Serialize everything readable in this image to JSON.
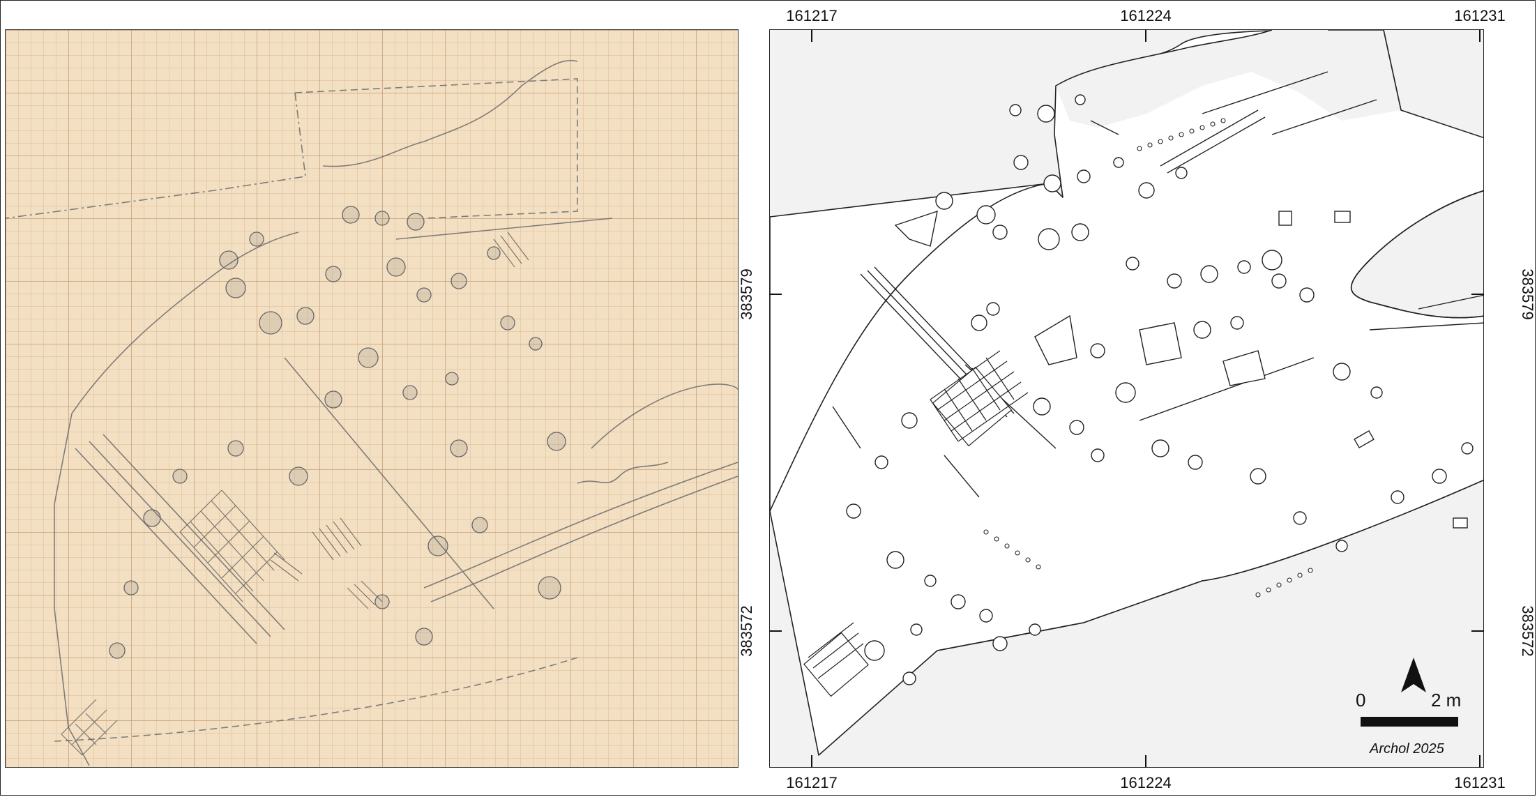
{
  "map": {
    "coords": {
      "x_top": [
        "161217",
        "161224",
        "161231"
      ],
      "x_bottom": [
        "161217",
        "161224",
        "161231"
      ],
      "y_left": [
        "383579",
        "383572"
      ],
      "y_right": [
        "383579",
        "383572"
      ]
    },
    "scale": {
      "start": "0",
      "end": "2 m"
    },
    "credit": "Archol 2025",
    "north_arrow": "north-arrow-icon",
    "colors": {
      "paper": "#f3dfc2",
      "grid": "#be966e",
      "pencil": "#5a5a5a",
      "map_bg": "#f2f2f2",
      "excavation": "#ffffff",
      "line": "#222222"
    }
  }
}
